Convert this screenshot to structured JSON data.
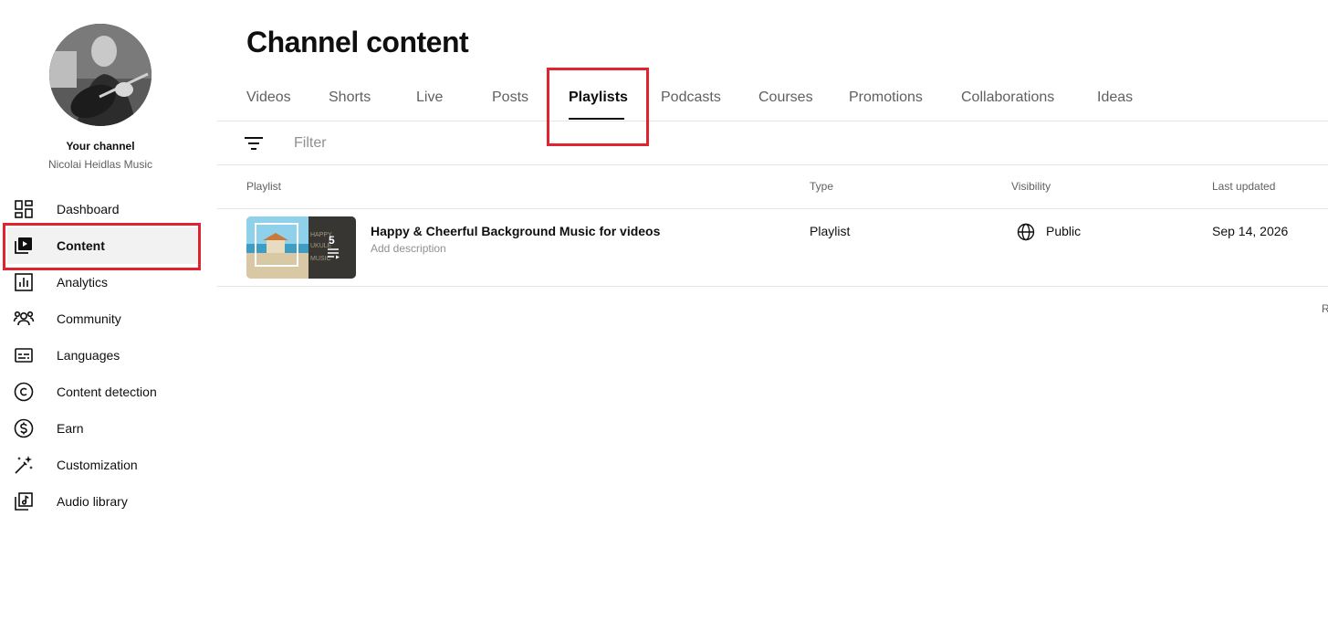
{
  "sidebar": {
    "your_channel": "Your channel",
    "channel_name": "Nicolai Heidlas Music",
    "items": [
      {
        "label": "Dashboard",
        "icon": "dashboard-icon"
      },
      {
        "label": "Content",
        "icon": "content-icon"
      },
      {
        "label": "Analytics",
        "icon": "analytics-icon"
      },
      {
        "label": "Community",
        "icon": "community-icon"
      },
      {
        "label": "Languages",
        "icon": "languages-icon"
      },
      {
        "label": "Content detection",
        "icon": "copyright-icon"
      },
      {
        "label": "Earn",
        "icon": "earn-icon"
      },
      {
        "label": "Customization",
        "icon": "magic-wand-icon"
      },
      {
        "label": "Audio library",
        "icon": "audio-library-icon"
      }
    ],
    "active_item": "Content"
  },
  "header": {
    "title": "Channel content"
  },
  "tabs": [
    "Videos",
    "Shorts",
    "Live",
    "Posts",
    "Playlists",
    "Podcasts",
    "Courses",
    "Promotions",
    "Collaborations",
    "Ideas"
  ],
  "active_tab": "Playlists",
  "filter": {
    "placeholder": "Filter"
  },
  "table": {
    "columns": [
      "Playlist",
      "Type",
      "Visibility",
      "Last updated"
    ],
    "rows": [
      {
        "title": "Happy & Cheerful Background Music for videos",
        "description": "Add description",
        "video_count": "5",
        "thumb_text": "HAPPY UKULE MUSIC",
        "type": "Playlist",
        "visibility": "Public",
        "last_updated": "Sep 14, 2026"
      }
    ]
  },
  "footer_partial": "R",
  "colors": {
    "highlight": "#e0232e",
    "active_bg": "#f2f2f2",
    "text_primary": "#0f0f0f",
    "text_secondary": "#606060"
  }
}
